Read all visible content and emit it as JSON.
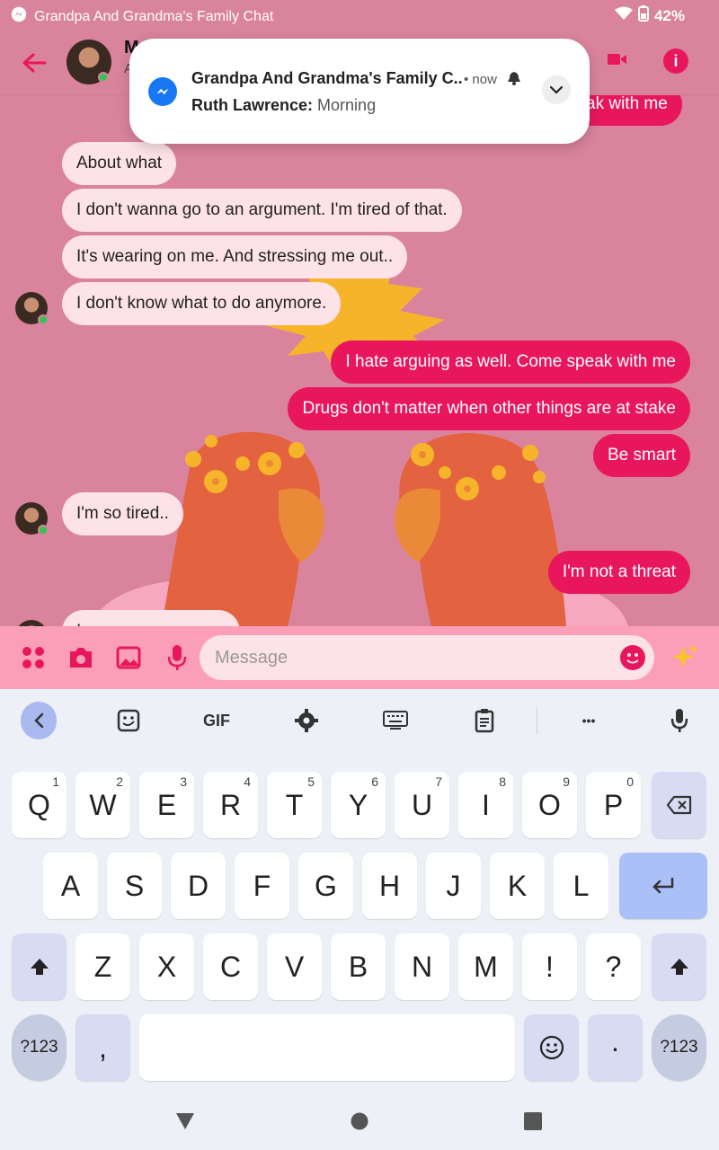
{
  "status_bar": {
    "app_title": "Grandpa And Grandma's Family Chat",
    "battery": "42%"
  },
  "header": {
    "contact_name": "M",
    "contact_sub": "A"
  },
  "notification": {
    "title": "Grandpa And Grandma's Family C..",
    "time": "• now",
    "sender": "Ruth Lawrence:",
    "message": "Morning"
  },
  "messages": [
    {
      "dir": "out",
      "text": "ak with me"
    },
    {
      "dir": "in",
      "text": "About what"
    },
    {
      "dir": "in",
      "text": "I don't wanna go to an argument. I'm tired of that."
    },
    {
      "dir": "in",
      "text": "It's wearing on me. And stressing me out.."
    },
    {
      "dir": "in",
      "text": "I don't know what to do anymore."
    },
    {
      "dir": "out",
      "text": "I hate arguing as well. Come speak with me"
    },
    {
      "dir": "out",
      "text": "Drugs don't matter when other things are at stake"
    },
    {
      "dir": "out",
      "text": "Be smart"
    },
    {
      "dir": "in",
      "text": "I'm so tired.."
    },
    {
      "dir": "out",
      "text": "I'm not a threat"
    },
    {
      "dir": "in",
      "text": "I ..."
    }
  ],
  "composer": {
    "placeholder": "Message"
  },
  "keyboard": {
    "toolbar_gif": "GIF",
    "toolbar_more": "•••",
    "row1": [
      "Q",
      "W",
      "E",
      "R",
      "T",
      "Y",
      "U",
      "I",
      "O",
      "P"
    ],
    "row1_hints": [
      "1",
      "2",
      "3",
      "4",
      "5",
      "6",
      "7",
      "8",
      "9",
      "0"
    ],
    "row2": [
      "A",
      "S",
      "D",
      "F",
      "G",
      "H",
      "J",
      "K",
      "L"
    ],
    "row3": [
      "Z",
      "X",
      "C",
      "V",
      "B",
      "N",
      "M",
      "!",
      "?"
    ],
    "symbols_left": "?123",
    "comma": ",",
    "period": "·",
    "symbols_right": "?123"
  },
  "colors": {
    "accent": "#e8175d",
    "chat_bg": "#d9839d",
    "bubble_in": "#fde2e8",
    "composer_bg": "#fb9fb8"
  },
  "icons": {
    "messenger": "messenger-icon",
    "wifi": "wifi-icon",
    "battery": "battery-icon",
    "back": "back-arrow-icon",
    "video": "video-call-icon",
    "info": "info-icon",
    "bell": "bell-icon",
    "expand": "chevron-down-icon"
  }
}
